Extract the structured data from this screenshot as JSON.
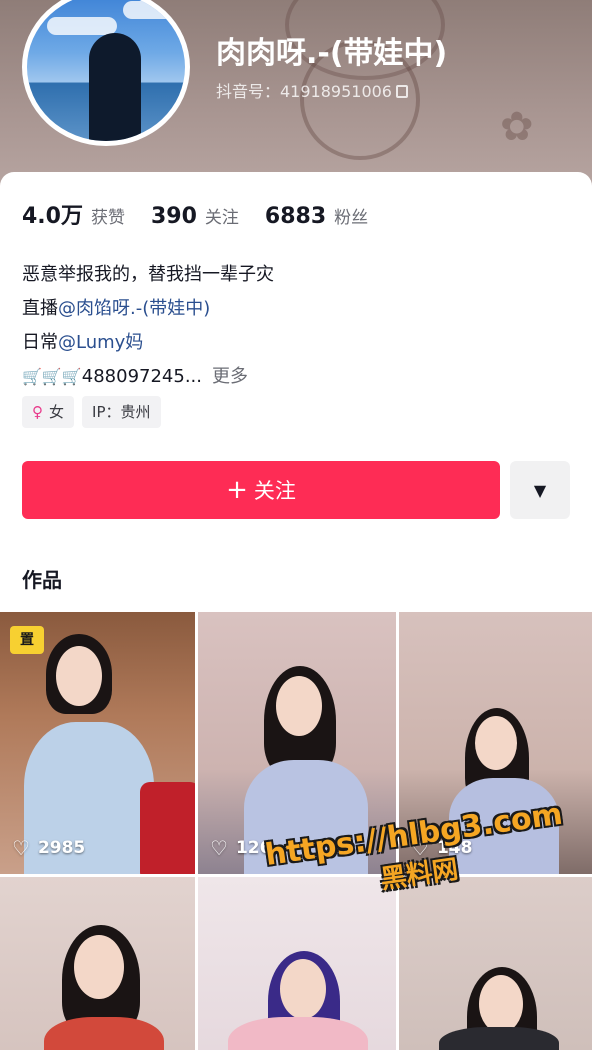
{
  "profile": {
    "name": "肉肉呀.-(带娃中)",
    "douyin_id": "抖音号：41918951006"
  },
  "stats": [
    {
      "value": "4.0万",
      "label": "获赞"
    },
    {
      "value": "390",
      "label": "关注"
    },
    {
      "value": "6883",
      "label": "粉丝"
    }
  ],
  "bio": {
    "line1": "恶意举报我的，替我挡一辈子灾",
    "line2_prefix": "直播",
    "line2_mention": "@肉馅呀.-(带娃中)",
    "line3_prefix": "日常",
    "line3_mention": "@Lumy妈",
    "line4_cart": "🛒🛒🛒",
    "line4_number": "488097245...",
    "more": "更多"
  },
  "tags": {
    "gender_icon": "♀",
    "gender": "女",
    "ip": "IP：贵州"
  },
  "actions": {
    "follow_plus": "+",
    "follow_label": "关注"
  },
  "works": {
    "title": "作品",
    "items": [
      {
        "likes": "2985",
        "pinned": true,
        "pin_label": "置"
      },
      {
        "likes": "126"
      },
      {
        "likes": "148"
      },
      {
        "likes": ""
      },
      {
        "likes": ""
      },
      {
        "likes": ""
      }
    ]
  },
  "watermark": {
    "url": "https://hlbg3.com",
    "site": "黑料网"
  },
  "colors": {
    "follow_button": "#fe2c55",
    "mention": "#2b4f8f",
    "watermark": "#f5a623"
  }
}
